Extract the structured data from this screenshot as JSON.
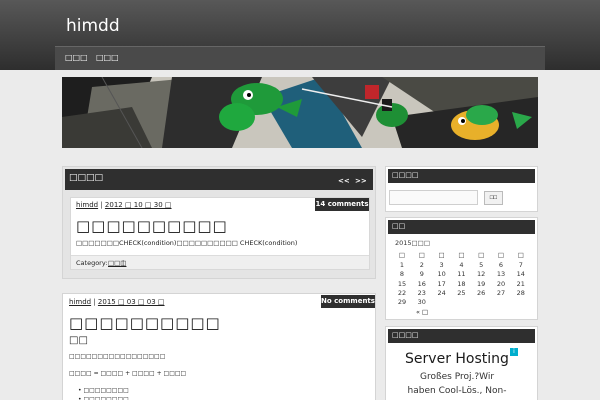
{
  "site": {
    "title": "himdd"
  },
  "nav": {
    "items": [
      "□□□",
      "□□□"
    ]
  },
  "main": {
    "header_title": "□□□□",
    "prev_label": "<<",
    "next_label": ">>"
  },
  "posts": [
    {
      "author": "himdd",
      "date": "2012 □ 10 □ 30 □",
      "comments": "14 comments",
      "title": "□□□□□□□□□□",
      "excerpt": "□□□□□□□CHECK(condition)□□□□□□□□□□ CHECK(condition)",
      "category_label": "Category:",
      "category": "□□□",
      "category_sep": "|"
    },
    {
      "author": "himdd",
      "date": "2015 □ 03 □ 03 □",
      "comments": "No comments",
      "title": "□□□□□□□□□□",
      "subtitle": "□□",
      "line1": "□□□□□□□□□□□□□□□□□",
      "line2": "□□□□ = □□□□ + □□□□ + □□□□",
      "bullets": [
        "□□□□□□□□",
        "□□□□□□□□"
      ]
    }
  ],
  "sidebar": {
    "search": {
      "title": "□□□□",
      "button": "□□",
      "value": ""
    },
    "calendar": {
      "title": "□□",
      "month": "2015□□□",
      "weekdays": [
        "□",
        "□",
        "□",
        "□",
        "□",
        "□",
        "□"
      ],
      "rows": [
        [
          "",
          "",
          "",
          "",
          "",
          "",
          "1"
        ],
        [
          "1",
          "2",
          "3",
          "4",
          "5",
          "6",
          "7"
        ],
        [
          "8",
          "9",
          "10",
          "11",
          "12",
          "13",
          "14"
        ],
        [
          "15",
          "16",
          "17",
          "18",
          "19",
          "20",
          "21"
        ],
        [
          "22",
          "23",
          "24",
          "25",
          "26",
          "27",
          "28"
        ],
        [
          "29",
          "30",
          "",
          "",
          "",
          "",
          ""
        ]
      ],
      "prev_link": "« □"
    },
    "ad": {
      "title": "□□□□",
      "headline": "Server Hosting",
      "line1": "Großes Proj.?Wir",
      "line2": "haben Cool-Lös., Non-"
    }
  }
}
